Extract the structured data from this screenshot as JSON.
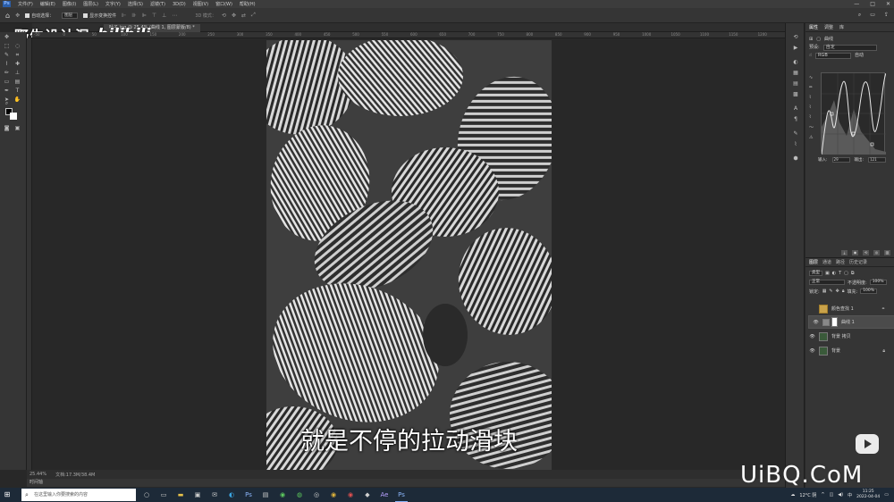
{
  "menubar": {
    "logo": "Ps",
    "items": [
      "文件(F)",
      "编辑(E)",
      "图像(I)",
      "图层(L)",
      "文字(Y)",
      "选择(S)",
      "滤镜(T)",
      "3D(D)",
      "视图(V)",
      "窗口(W)",
      "帮助(H)"
    ],
    "controls": [
      "—",
      "□",
      "✕"
    ]
  },
  "optbar": {
    "home": "⌂",
    "auto_select": "自动选择：",
    "auto_select_value": "图层",
    "show_transform": "显示变换控件",
    "mode_3d": "3D 模式："
  },
  "watermark": {
    "channel": "野生设计湿",
    "logo": "bilibili"
  },
  "document": {
    "tab": "叶子.jpg @ 25.4% (曲线 1, 图层蒙版/8) *"
  },
  "ruler": {
    "labels": [
      "-50",
      "0",
      "50",
      "100",
      "150",
      "200",
      "250",
      "300",
      "350",
      "400",
      "450",
      "500",
      "550",
      "600",
      "650",
      "700",
      "750",
      "800",
      "850",
      "900",
      "950",
      "1000",
      "1050",
      "1100",
      "1150",
      "1200"
    ]
  },
  "subtitle": "就是不停的拉动滑块",
  "statusbar": {
    "zoom": "25.44%",
    "doc": "文档:17.3M/38.4M"
  },
  "timeline": "时间轴",
  "properties": {
    "tabs": [
      "属性",
      "调整",
      "库"
    ],
    "title": "曲线",
    "preset_label": "预设:",
    "preset_value": "自定",
    "channel_value": "RGB",
    "auto": "自动",
    "input_label": "输入:",
    "input_value": "29",
    "output_label": "输出:",
    "output_value": "121"
  },
  "layers": {
    "tabs": [
      "图层",
      "通道",
      "路径",
      "历史记录"
    ],
    "filter": "类型",
    "blend_mode": "正常",
    "opacity_label": "不透明度:",
    "opacity_value": "100%",
    "lock_label": "锁定:",
    "fill_label": "填充:",
    "fill_value": "100%",
    "items": [
      {
        "name": "颜色查找 1",
        "selected": false
      },
      {
        "name": "曲线 1",
        "selected": true
      },
      {
        "name": "背景 拷贝",
        "selected": false
      },
      {
        "name": "背景",
        "selected": false
      }
    ]
  },
  "brand": "UiBQ.CoM",
  "taskbar": {
    "search_placeholder": "在这里输入你要搜索的内容",
    "weather": "12°C 阴",
    "time": "11:25",
    "date": "2022-04-04"
  }
}
